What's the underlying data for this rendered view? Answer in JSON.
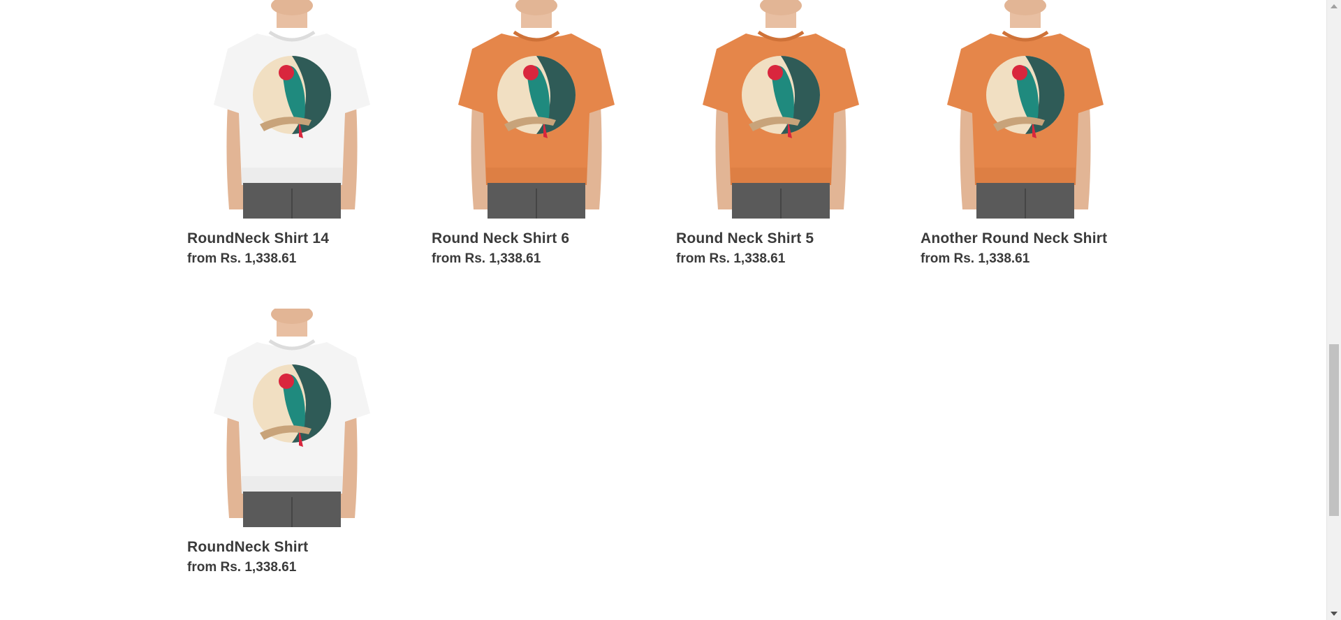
{
  "products": [
    {
      "title": "RoundNeck Shirt 14",
      "price": "from Rs. 1,338.61",
      "shirt_color": "#f4f4f4"
    },
    {
      "title": "Round Neck Shirt 6",
      "price": "from Rs. 1,338.61",
      "shirt_color": "#e5864a"
    },
    {
      "title": "Round Neck Shirt 5",
      "price": "from Rs. 1,338.61",
      "shirt_color": "#e5864a"
    },
    {
      "title": "Another Round Neck Shirt",
      "price": "from Rs. 1,338.61",
      "shirt_color": "#e5864a"
    },
    {
      "title": "RoundNeck Shirt",
      "price": "from Rs. 1,338.61",
      "shirt_color": "#f4f4f4"
    }
  ]
}
